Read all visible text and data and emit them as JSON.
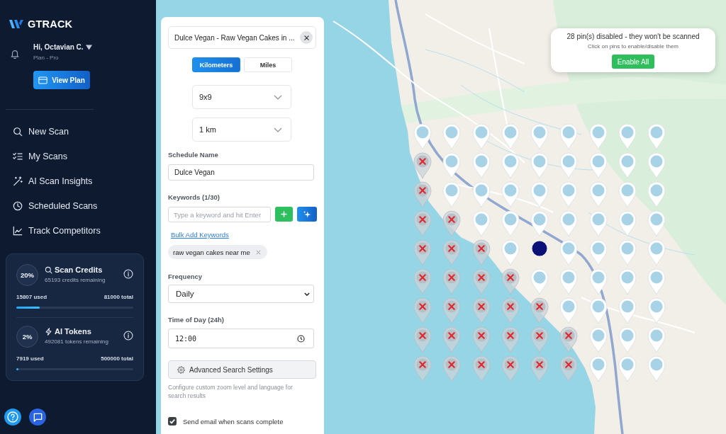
{
  "sidebar": {
    "logo": "GTRACK",
    "user": {
      "greeting": "Hi, Octavian C.",
      "plan": "Plan - Pro"
    },
    "view_plan_button": "View Plan",
    "nav": [
      {
        "label": "New Scan",
        "selected": false
      },
      {
        "label": "My Scans",
        "selected": false
      },
      {
        "label": "AI Scan Insights",
        "selected": false
      },
      {
        "label": "Scheduled Scans",
        "selected": false
      },
      {
        "label": "Track Competitors",
        "selected": false
      }
    ],
    "usage": [
      {
        "percent": "20%",
        "title": "Scan Credits",
        "remaining": "65193 credits remaining",
        "used": "15807 used",
        "total": "81000 total",
        "level": 0.2
      },
      {
        "percent": "2%",
        "title": "AI Tokens",
        "remaining": "492081 tokens remaining",
        "used": "7919 used",
        "total": "500000 total",
        "level": 0.02
      }
    ]
  },
  "form": {
    "location": {
      "value": "Dulce Vegan - Raw Vegan Cakes in ..."
    },
    "units": [
      {
        "label": "Kilometers",
        "selected": true
      },
      {
        "label": "Miles",
        "selected": false
      }
    ],
    "grid_size": {
      "value": "9x9"
    },
    "radius": {
      "value": "1 km"
    },
    "schedule_name": {
      "label": "Schedule Name",
      "value": "Dulce Vegan"
    },
    "keywords": {
      "label": "Keywords (1/30)",
      "placeholder": "Type a keyword and hit Enter",
      "bulk_link": "Bulk Add Keywords",
      "chips": [
        {
          "text": "raw vegan cakes near me"
        }
      ]
    },
    "frequency": {
      "label": "Frequency",
      "value": "Daily"
    },
    "time": {
      "label": "Time of Day (24h)",
      "value": "12:00"
    },
    "advanced_button": "Advanced Search Settings",
    "advanced_hint": "Configure custom zoom level and language for search results",
    "email": {
      "label": "Send email when scans complete",
      "checked": true
    }
  },
  "map": {
    "popup": {
      "title": "28 pin(s) disabled - they won't be scanned",
      "hint": "Click on pins to enable/disable them",
      "button": "Enable All"
    },
    "rows": [
      {
        "pins": [
          {
            "kind": "pin",
            "disabled": false
          },
          {
            "kind": "pin",
            "disabled": false
          },
          {
            "kind": "pin",
            "disabled": false
          },
          {
            "kind": "pin",
            "disabled": false
          },
          {
            "kind": "pin",
            "disabled": false
          },
          {
            "kind": "pin",
            "disabled": false
          },
          {
            "kind": "pin",
            "disabled": false
          },
          {
            "kind": "pin",
            "disabled": false
          },
          {
            "kind": "pin",
            "disabled": false
          }
        ]
      },
      {
        "pins": [
          {
            "kind": "pin",
            "disabled": true
          },
          {
            "kind": "pin",
            "disabled": false
          },
          {
            "kind": "pin",
            "disabled": false
          },
          {
            "kind": "pin",
            "disabled": false
          },
          {
            "kind": "pin",
            "disabled": false
          },
          {
            "kind": "pin",
            "disabled": false
          },
          {
            "kind": "pin",
            "disabled": false
          },
          {
            "kind": "pin",
            "disabled": false
          },
          {
            "kind": "pin",
            "disabled": false
          }
        ]
      },
      {
        "pins": [
          {
            "kind": "pin",
            "disabled": true
          },
          {
            "kind": "pin",
            "disabled": false
          },
          {
            "kind": "pin",
            "disabled": false
          },
          {
            "kind": "pin",
            "disabled": false
          },
          {
            "kind": "pin",
            "disabled": false
          },
          {
            "kind": "pin",
            "disabled": false
          },
          {
            "kind": "pin",
            "disabled": false
          },
          {
            "kind": "pin",
            "disabled": false
          },
          {
            "kind": "pin",
            "disabled": false
          }
        ]
      },
      {
        "pins": [
          {
            "kind": "pin",
            "disabled": true
          },
          {
            "kind": "pin",
            "disabled": true
          },
          {
            "kind": "pin",
            "disabled": false
          },
          {
            "kind": "pin",
            "disabled": false
          },
          {
            "kind": "pin",
            "disabled": false
          },
          {
            "kind": "pin",
            "disabled": false
          },
          {
            "kind": "pin",
            "disabled": false
          },
          {
            "kind": "pin",
            "disabled": false
          },
          {
            "kind": "pin",
            "disabled": false
          }
        ]
      },
      {
        "pins": [
          {
            "kind": "pin",
            "disabled": true
          },
          {
            "kind": "pin",
            "disabled": true
          },
          {
            "kind": "pin",
            "disabled": true
          },
          {
            "kind": "pin",
            "disabled": false
          },
          {
            "kind": "center",
            "disabled": false
          },
          {
            "kind": "pin",
            "disabled": false
          },
          {
            "kind": "pin",
            "disabled": false
          },
          {
            "kind": "pin",
            "disabled": false
          },
          {
            "kind": "pin",
            "disabled": false
          }
        ]
      },
      {
        "pins": [
          {
            "kind": "pin",
            "disabled": true
          },
          {
            "kind": "pin",
            "disabled": true
          },
          {
            "kind": "pin",
            "disabled": true
          },
          {
            "kind": "pin",
            "disabled": true
          },
          {
            "kind": "pin",
            "disabled": false
          },
          {
            "kind": "pin",
            "disabled": false
          },
          {
            "kind": "pin",
            "disabled": false
          },
          {
            "kind": "pin",
            "disabled": false
          },
          {
            "kind": "pin",
            "disabled": false
          }
        ]
      },
      {
        "pins": [
          {
            "kind": "pin",
            "disabled": true
          },
          {
            "kind": "pin",
            "disabled": true
          },
          {
            "kind": "pin",
            "disabled": true
          },
          {
            "kind": "pin",
            "disabled": true
          },
          {
            "kind": "pin",
            "disabled": true
          },
          {
            "kind": "pin",
            "disabled": false
          },
          {
            "kind": "pin",
            "disabled": false
          },
          {
            "kind": "pin",
            "disabled": false
          },
          {
            "kind": "pin",
            "disabled": false
          }
        ]
      },
      {
        "pins": [
          {
            "kind": "pin",
            "disabled": true
          },
          {
            "kind": "pin",
            "disabled": true
          },
          {
            "kind": "pin",
            "disabled": true
          },
          {
            "kind": "pin",
            "disabled": true
          },
          {
            "kind": "pin",
            "disabled": true
          },
          {
            "kind": "pin",
            "disabled": true
          },
          {
            "kind": "pin",
            "disabled": false
          },
          {
            "kind": "pin",
            "disabled": false
          },
          {
            "kind": "pin",
            "disabled": false
          }
        ]
      },
      {
        "pins": [
          {
            "kind": "pin",
            "disabled": true
          },
          {
            "kind": "pin",
            "disabled": true
          },
          {
            "kind": "pin",
            "disabled": true
          },
          {
            "kind": "pin",
            "disabled": true
          },
          {
            "kind": "pin",
            "disabled": true
          },
          {
            "kind": "pin",
            "disabled": true
          },
          {
            "kind": "pin",
            "disabled": false
          },
          {
            "kind": "pin",
            "disabled": false
          },
          {
            "kind": "pin",
            "disabled": false
          }
        ]
      }
    ]
  }
}
